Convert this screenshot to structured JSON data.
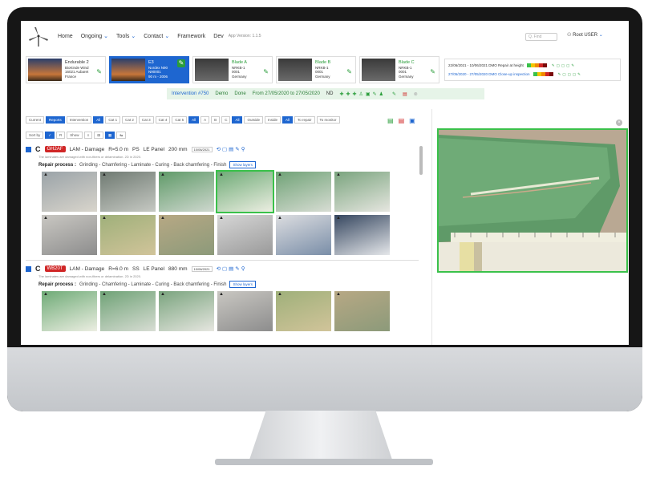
{
  "nav": {
    "items": [
      {
        "label": "Home",
        "chevron": false
      },
      {
        "label": "Ongoing",
        "chevron": true
      },
      {
        "label": "Tools",
        "chevron": true
      },
      {
        "label": "Contact",
        "chevron": true
      },
      {
        "label": "Framework",
        "chevron": false
      },
      {
        "label": "Dev",
        "chevron": false
      }
    ],
    "app_version": "App Version: 1.1.5",
    "search_placeholder": "Q. Find",
    "user": "Root USER"
  },
  "turbines": [
    {
      "title": "Endurable 2",
      "l1": "BioKinde Wind",
      "l2": "16021 Aubaret",
      "l3": "France",
      "active": false,
      "dark": false
    },
    {
      "title": "E3",
      "l1": "Nordex N90",
      "l2": "N90001",
      "l3": "90 m - 2006",
      "active": true,
      "dark": false
    },
    {
      "title": "Blade A",
      "l1": "NRKB-1",
      "l2": "0001",
      "l3": "Germany",
      "active": false,
      "dark": true
    },
    {
      "title": "Blade B",
      "l1": "NRKB-1",
      "l2": "0001",
      "l3": "Germany",
      "active": false,
      "dark": true
    },
    {
      "title": "Blade C",
      "l1": "NRKB-1",
      "l2": "0001",
      "l3": "Germany",
      "active": false,
      "dark": true
    }
  ],
  "inspections": [
    {
      "text": "22/06/2021 - 10/06/2021  DMO  Repair at height",
      "selected": false
    },
    {
      "text": "27/05/2020 - 27/05/2020  DMO  Close-up inspection",
      "selected": true
    }
  ],
  "intervention": {
    "number": "Intervention #750",
    "client": "Demo",
    "status": "Done",
    "dates": "From 27/05/2020 to 27/05/2020",
    "code": "ND"
  },
  "filters": {
    "row1": [
      {
        "label": "Current",
        "on": false
      },
      {
        "label": "Reports",
        "on": true
      },
      {
        "label": "Intervention",
        "on": false
      },
      {
        "label": "All",
        "on": true
      },
      {
        "label": "Cat 1",
        "on": false
      },
      {
        "label": "Cat 2",
        "on": false
      },
      {
        "label": "Cat 3",
        "on": false
      },
      {
        "label": "Cat 4",
        "on": false
      },
      {
        "label": "Cat 5",
        "on": false
      },
      {
        "label": "All",
        "on": true
      },
      {
        "label": "A",
        "on": false
      },
      {
        "label": "B",
        "on": false
      },
      {
        "label": "C",
        "on": false
      },
      {
        "label": "All",
        "on": true
      },
      {
        "label": "Outside",
        "on": false
      },
      {
        "label": "Inside",
        "on": false
      },
      {
        "label": "All",
        "on": true
      },
      {
        "label": "To repair",
        "on": false
      },
      {
        "label": "To monitor",
        "on": false
      }
    ],
    "row2": [
      {
        "label": "Sort by",
        "on": false
      },
      {
        "label": "✓",
        "on": true
      },
      {
        "label": "R",
        "on": false
      },
      {
        "label": "Show",
        "on": false
      },
      {
        "label": "≡",
        "on": false
      },
      {
        "label": "⊞",
        "on": false
      },
      {
        "label": "▦",
        "on": true
      },
      {
        "label": "⇆",
        "on": false
      }
    ]
  },
  "damages": [
    {
      "code": "GH2AF",
      "type": "LAM - Damage",
      "radius": "R=5.0 m",
      "side": "PS",
      "zone": "LE Panel",
      "size": "200 mm",
      "date": "10/06/2021",
      "sub": "The laminates are damaged with non-fibers or delamination. 2D in 2020.",
      "repair_label": "Repair process :",
      "repair_steps": "Grinding - Chamfering - Laminate - Curing - Back chamfering - Finish",
      "show_layers": "Show layers",
      "photos": 12
    },
    {
      "code": "WB20T",
      "type": "LAM - Damage",
      "radius": "R=6.0 m",
      "side": "SS",
      "zone": "LE Panel",
      "size": "880 mm",
      "date": "10/06/2021",
      "sub": "The laminates are damaged with non-fibers or delamination. 2D in 2020.",
      "repair_label": "Repair process :",
      "repair_steps": "Grinding - Chamfering - Laminate - Curing - Back chamfering - Finish",
      "show_layers": "Show layers",
      "photos": 6
    }
  ],
  "colors": {
    "accent": "#1e66d0",
    "green": "#3ac14a",
    "red": "#d02626"
  }
}
